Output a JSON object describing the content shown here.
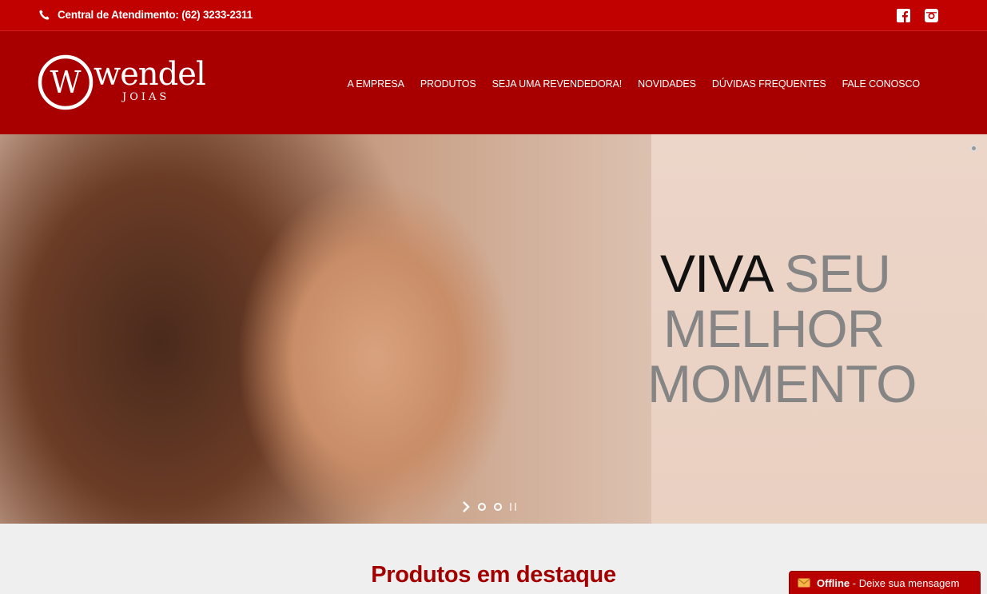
{
  "topbar": {
    "phone_text": "Central de Atendimento: (62) 3233-2311",
    "icons": [
      "phone-icon",
      "facebook-icon",
      "instagram-icon"
    ]
  },
  "brand": {
    "logo_letter": "W",
    "name": "wendel",
    "subtitle": "JOIAS"
  },
  "nav": {
    "items": [
      {
        "label": "A EMPRESA"
      },
      {
        "label": "PRODUTOS"
      },
      {
        "label": "SEJA UMA REVENDEDORA!"
      },
      {
        "label": "NOVIDADES"
      },
      {
        "label": "DÚVIDAS FREQUENTES"
      },
      {
        "label": "FALE CONOSCO"
      }
    ]
  },
  "hero": {
    "word1": "VIVA",
    "word2": "SEU",
    "line2": "MELHOR",
    "line3": "MOMENTO"
  },
  "featured": {
    "title": "Produtos em destaque"
  },
  "chat": {
    "status": "Offline",
    "message": "- Deixe sua mensagem"
  },
  "colors": {
    "topbar": "#c10000",
    "header": "#a80000",
    "title_red": "#a20000"
  }
}
